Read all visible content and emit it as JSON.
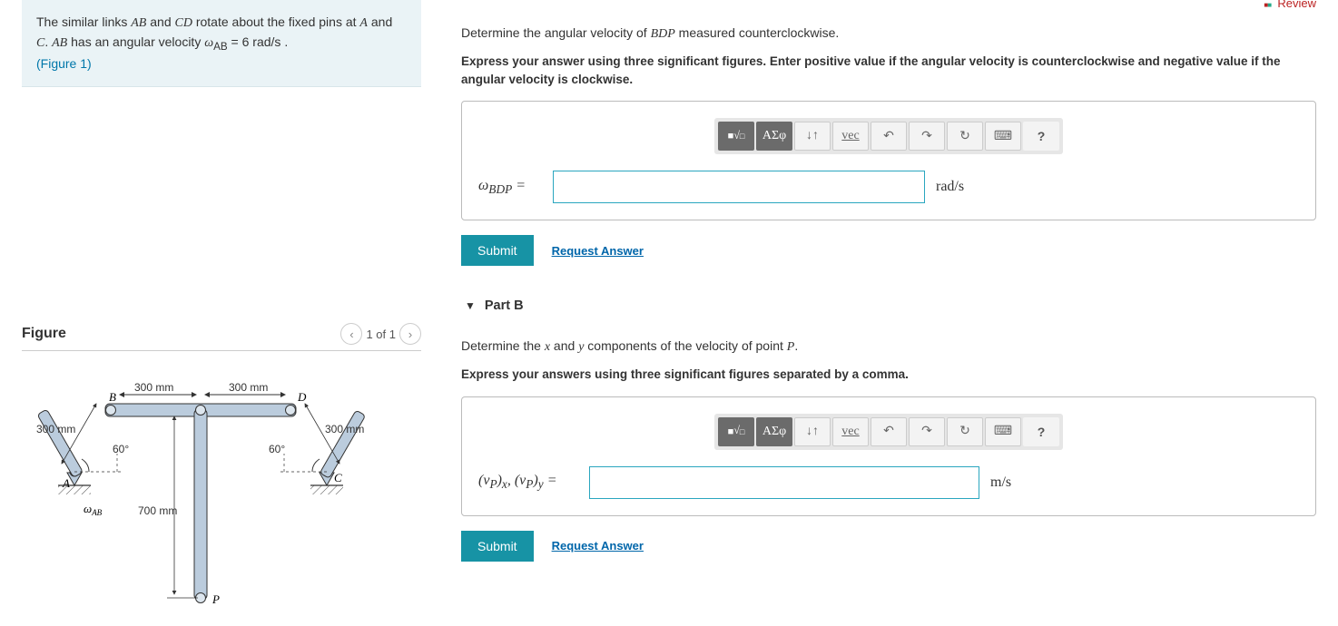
{
  "review_link": "Review",
  "problem": {
    "text1": "The similar links ",
    "var1": "AB",
    "text2": " and ",
    "var2": "CD",
    "text3": " rotate about the fixed pins at ",
    "var3": "A",
    "text4": " and ",
    "var4": "C",
    "text5": ". ",
    "var5": "AB",
    "text6": " has an angular velocity ",
    "var6": "ω",
    "sub6": "AB",
    "text7": " = 6  rad/s .",
    "figref": "(Figure 1)"
  },
  "figure": {
    "heading": "Figure",
    "pos": "1 of 1",
    "dim_bd1": "300 mm",
    "dim_bd2": "300 mm",
    "dim_ab": "300 mm",
    "dim_cd": "300 mm",
    "dim_dp": "700 mm",
    "ang1": "60°",
    "ang2": "60°",
    "lblA": "A",
    "lblB": "B",
    "lblC": "C",
    "lblD": "D",
    "lblP": "P",
    "wab": "ω",
    "wab_sub": "AB"
  },
  "partA": {
    "q": "Determine the angular velocity of ",
    "qvar": "BDP",
    "q2": " measured counterclockwise.",
    "instr": "Express your answer using three significant figures. Enter positive value if the angular velocity is counterclockwise and negative value if the angular velocity is clockwise.",
    "label_w": "ω",
    "label_sub": "BDP",
    "label_eq": " = ",
    "unit": "rad/s",
    "submit": "Submit",
    "request": "Request Answer"
  },
  "partB": {
    "title": "Part B",
    "q1": "Determine the ",
    "vx": "x",
    "q2": " and ",
    "vy": "y",
    "q3": " components of the velocity of point ",
    "vp": "P",
    "q4": ".",
    "instr": "Express your answers using three significant figures separated by a comma.",
    "label": "(v_P)_x, (v_P)_y = ",
    "unit": "m/s",
    "submit": "Submit",
    "request": "Request Answer"
  },
  "toolbar": {
    "tmpl": "□√□",
    "greek": "ΑΣφ",
    "subsup": "↓↑",
    "vec": "vec",
    "undo": "↶",
    "redo": "↷",
    "reset": "↻",
    "kbd": "⌨",
    "help": "?"
  }
}
